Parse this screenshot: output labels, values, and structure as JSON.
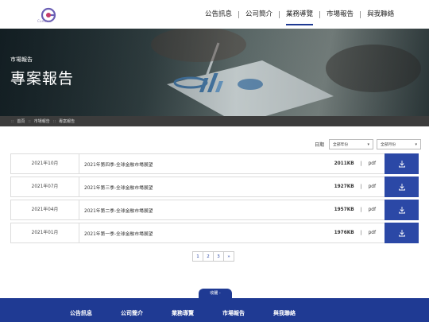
{
  "brand": {
    "logo_text": "Cueutus"
  },
  "nav": {
    "items": [
      "公告訊息",
      "公司簡介",
      "業務導覽",
      "市場報告",
      "與我聯絡"
    ],
    "active_index": 2
  },
  "banner": {
    "subtitle": "市場報告",
    "title": "專案報告"
  },
  "breadcrumb": [
    "首頁",
    "市場報告",
    "專案報告"
  ],
  "filters": {
    "label": "日期",
    "year_select": "全部年份",
    "month_select": "全部月份"
  },
  "reports": [
    {
      "date": "2021年10月",
      "title": "2021年第四季-全球金融市場展望",
      "size": "2011KB",
      "sep": "|",
      "type": "pdf"
    },
    {
      "date": "2021年07月",
      "title": "2021年第三季-全球金融市場展望",
      "size": "1927KB",
      "sep": "|",
      "type": "pdf"
    },
    {
      "date": "2021年04月",
      "title": "2021年第二季-全球金融市場展望",
      "size": "1957KB",
      "sep": "|",
      "type": "pdf"
    },
    {
      "date": "2021年01月",
      "title": "2021年第一季-全球金融市場展望",
      "size": "1976KB",
      "sep": "|",
      "type": "pdf"
    }
  ],
  "pagination": [
    "1",
    "2",
    "3",
    "»"
  ],
  "footer": {
    "tab_label": "收闔 -",
    "items": [
      "公告訊息",
      "公司簡介",
      "業務導覽",
      "市場報告",
      "與我聯絡"
    ]
  },
  "colors": {
    "accent": "#2b48a6",
    "footer": "#1f3a93",
    "crumbbar": "#3c3c3c"
  }
}
